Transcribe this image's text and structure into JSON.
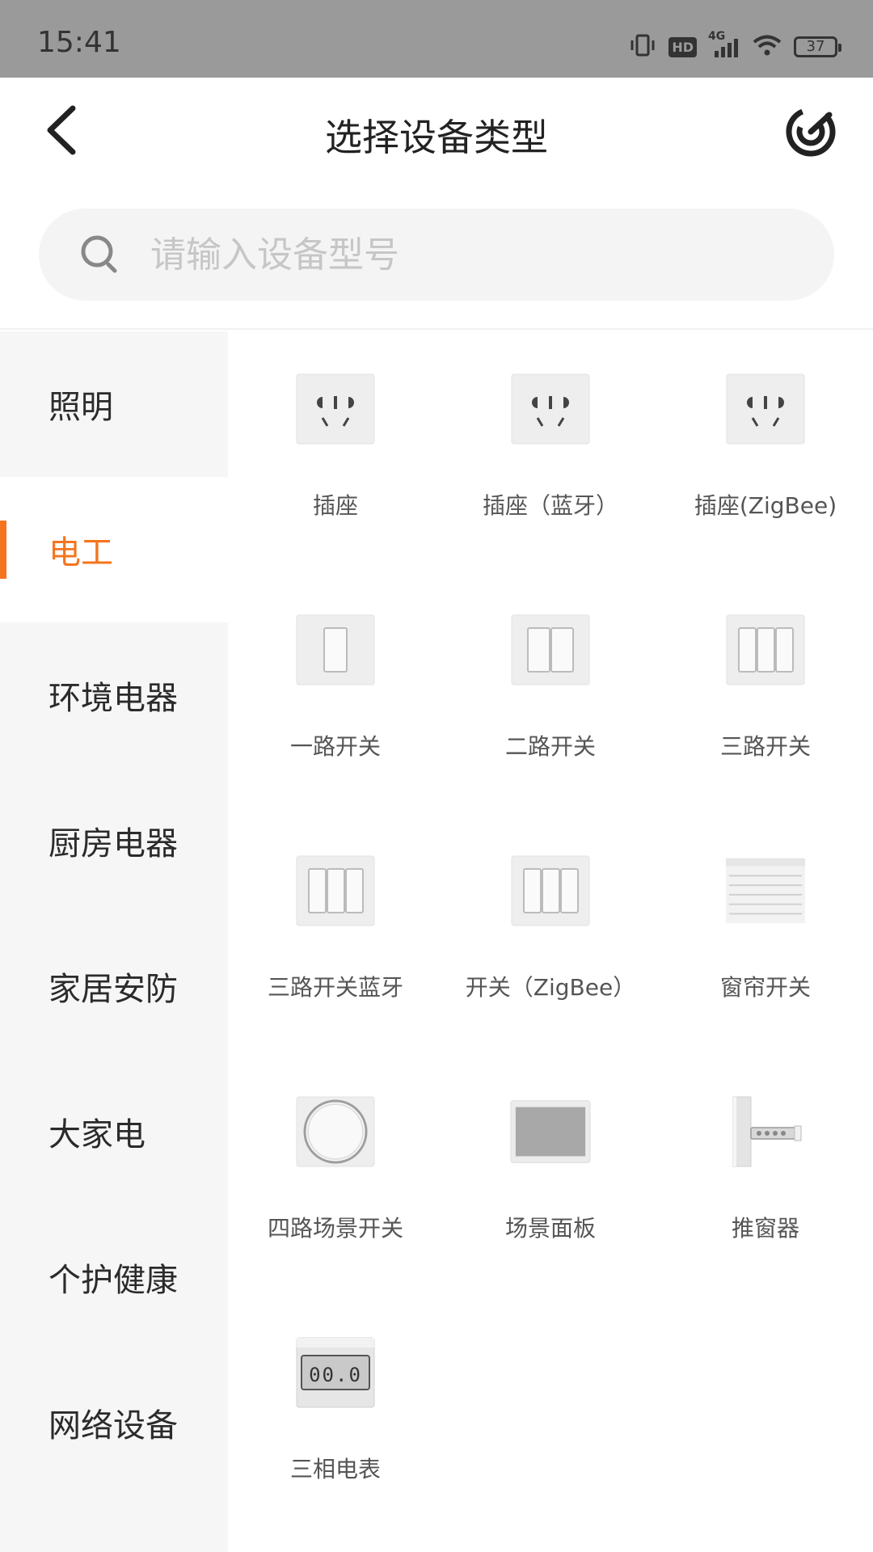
{
  "status_bar": {
    "time": "15:41",
    "hd_label": "HD",
    "network_label": "4G",
    "battery": "37"
  },
  "header": {
    "title": "选择设备类型"
  },
  "search": {
    "placeholder": "请输入设备型号"
  },
  "sidebar": {
    "items": [
      {
        "label": "照明",
        "active": false
      },
      {
        "label": "电工",
        "active": true
      },
      {
        "label": "环境电器",
        "active": false
      },
      {
        "label": "厨房电器",
        "active": false
      },
      {
        "label": "家居安防",
        "active": false
      },
      {
        "label": "大家电",
        "active": false
      },
      {
        "label": "个护健康",
        "active": false
      },
      {
        "label": "网络设备",
        "active": false
      }
    ]
  },
  "devices": [
    {
      "label": "插座",
      "icon": "socket-icon"
    },
    {
      "label": "插座（蓝牙）",
      "icon": "socket-icon"
    },
    {
      "label": "插座(ZigBee)",
      "icon": "socket-icon"
    },
    {
      "label": "一路开关",
      "icon": "switch-1-gang-icon"
    },
    {
      "label": "二路开关",
      "icon": "switch-2-gang-icon"
    },
    {
      "label": "三路开关",
      "icon": "switch-3-gang-icon"
    },
    {
      "label": "三路开关蓝牙",
      "icon": "switch-3-gang-icon"
    },
    {
      "label": "开关（ZigBee）",
      "icon": "switch-3-gang-icon"
    },
    {
      "label": "窗帘开关",
      "icon": "blind-icon"
    },
    {
      "label": "四路场景开关",
      "icon": "round-knob-icon"
    },
    {
      "label": "场景面板",
      "icon": "panel-icon"
    },
    {
      "label": "推窗器",
      "icon": "window-pusher-icon"
    },
    {
      "label": "三相电表",
      "icon": "meter-icon"
    }
  ],
  "meter_reading": "00.0"
}
